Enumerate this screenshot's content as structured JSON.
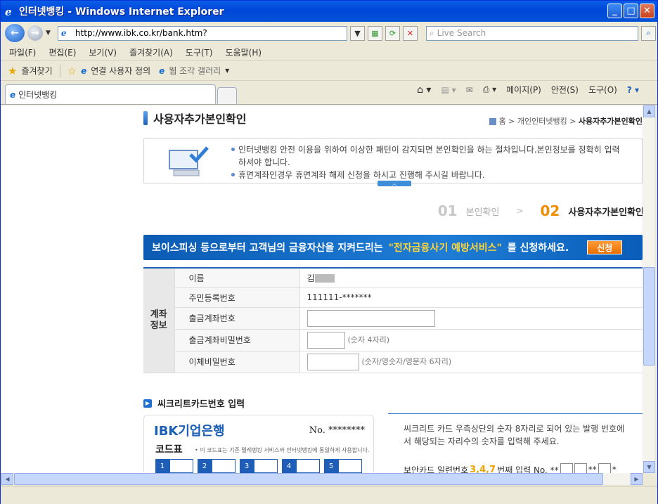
{
  "window": {
    "title": "인터넷뱅킹 - Windows Internet Explorer"
  },
  "address": {
    "url": "http://www.ibk.co.kr/bank.htm?",
    "search_placeholder": "Live Search"
  },
  "menu": [
    "파일(F)",
    "편집(E)",
    "보기(V)",
    "즐겨찾기(A)",
    "도구(T)",
    "도움말(H)"
  ],
  "favorites": {
    "label": "즐겨찾기",
    "item1": "연결 사용자 정의",
    "item2": "웹 조각 갤러리"
  },
  "tab": {
    "label": "인터넷뱅킹"
  },
  "tools": {
    "page": "페이지(P)",
    "safety": "안전(S)",
    "tools": "도구(O)"
  },
  "page": {
    "title": "사용자추가본인확인",
    "breadcrumb": {
      "home": "홈",
      "sep1": ">",
      "mid": "개인인터넷뱅킹",
      "sep2": ">",
      "current": "사용자추가본인확인"
    },
    "info": [
      "인터넷뱅킹 안전 이용을 위하여 이상한 패턴이 감지되면 본인확인을 하는 절차입니다.본인정보를 정확히 입력하셔야 합니다.",
      "휴면계좌인경우 휴면계좌 해제 신청을 하시고 진행해 주시길 바랍니다."
    ],
    "steps": [
      {
        "num": "01",
        "label": "본인확인",
        "active": false
      },
      {
        "num": "02",
        "label": "사용자추가본인확인",
        "active": true
      }
    ],
    "step_arrow": ">",
    "banner": {
      "text1": "보이스피싱 등으로부터 고객님의 금융자산을 지켜드리는",
      "highlight": "\"전자금융사기 예방서비스\"",
      "text2": "를 신청하세요.",
      "button": "신청"
    },
    "account": {
      "group": "계좌\n정보",
      "rows": [
        {
          "label": "이름",
          "value": "김"
        },
        {
          "label": "주민등록번호",
          "value": "111111-*******"
        },
        {
          "label": "출금계좌번호",
          "value": ""
        },
        {
          "label": "출금계좌비밀번호",
          "hint": "(숫자 4자리)"
        },
        {
          "label": "이체비밀번호",
          "hint": "(숫자/영숫자/영문자 6자리)"
        }
      ]
    },
    "secret": {
      "title": "씨크리트카드번호 입력",
      "card": {
        "logo": "IBK기업은행",
        "no_label": "No.",
        "no_value": "********",
        "code_title": "코드표",
        "code_note": "• 이 코드표는 기존 텔레뱅킹 서비스와 인터넷뱅킹에 통일하게 사용합니다.",
        "cells": [
          "1",
          "2",
          "3",
          "4",
          "5"
        ]
      },
      "desc": "씨크리트 카드 우측상단의 숫자 8자리로 되어 있는 발행 번호에서 해당되는 자리수의 숫자를 입력해 주세요.",
      "serial_label": "보안카드 일련번호",
      "serial_digits": "3,4,7",
      "serial_suffix": "번째 입력 No. **",
      "serial_mid": "**",
      "serial_end": "*"
    }
  }
}
